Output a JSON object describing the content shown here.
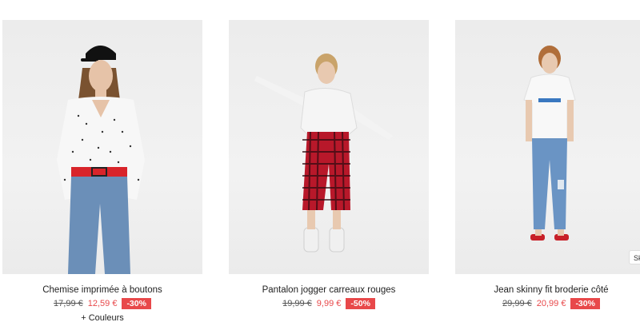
{
  "products": [
    {
      "name": "Chemise imprimée à boutons",
      "old_price": "17,99 €",
      "new_price": "12,59 €",
      "discount": "-30%",
      "extra": "+ Couleurs"
    },
    {
      "name": "Pantalon jogger carreaux rouges",
      "old_price": "19,99 €",
      "new_price": "9,99 €",
      "discount": "-50%"
    },
    {
      "name": "Jean skinny fit broderie côté",
      "old_price": "29,99 €",
      "new_price": "20,99 €",
      "discount": "-30%"
    }
  ],
  "side_tab_label": "Sk",
  "colors": {
    "sale_red": "#e8484a",
    "photo_bg": "#ececec"
  }
}
